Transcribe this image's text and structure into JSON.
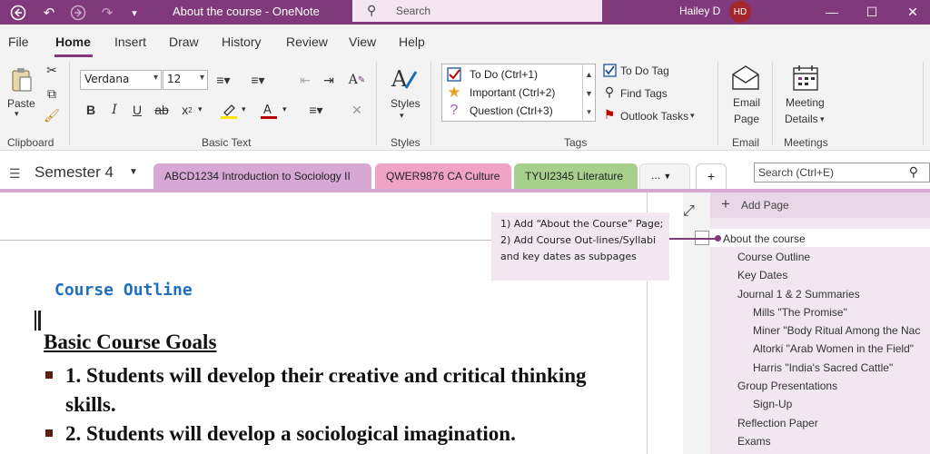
{
  "titlebar": {
    "title": "About the course  -  OneNote",
    "search_placeholder": "Search",
    "user_name": "Hailey D",
    "user_initials": "HD"
  },
  "menu": {
    "tabs": [
      "File",
      "Home",
      "Insert",
      "Draw",
      "History",
      "Review",
      "View",
      "Help"
    ],
    "active": "Home"
  },
  "ribbon": {
    "clipboard": {
      "paste_label": "Paste",
      "group_label": "Clipboard"
    },
    "basic_text": {
      "font": "Verdana",
      "size": "12",
      "group_label": "Basic Text"
    },
    "styles": {
      "label": "Styles",
      "group_label": "Styles"
    },
    "tags": {
      "items": [
        {
          "label": "To Do (Ctrl+1)",
          "icon": "checkbox-icon"
        },
        {
          "label": "Important (Ctrl+2)",
          "icon": "star-icon"
        },
        {
          "label": "Question (Ctrl+3)",
          "icon": "question-icon"
        }
      ],
      "todo_tag": "To Do Tag",
      "find_tags": "Find Tags",
      "outlook_tasks": "Outlook Tasks",
      "group_label": "Tags"
    },
    "email": {
      "label_line1": "Email",
      "label_line2": "Page",
      "group_label": "Email"
    },
    "meetings": {
      "label_line1": "Meeting",
      "label_line2": "Details",
      "group_label": "Meetings"
    }
  },
  "notebook": {
    "name": "Semester 4",
    "sections": [
      {
        "label": "ABCD1234 Introduction to Sociology II",
        "color": "#d8a8d4"
      },
      {
        "label": "QWER9876 CA Culture",
        "color": "#f0a3c4"
      },
      {
        "label": "TYUI2345 Literature",
        "color": "#a8d08d"
      }
    ],
    "more_label": "...",
    "add_label": "+",
    "search_placeholder": "Search (Ctrl+E)"
  },
  "page": {
    "note": "1) Add “About the Course” Page; 2) Add Course Out-lines/Syllabi and key dates as subpages",
    "outline_title": "Course Outline",
    "goals_heading": "Basic Course Goals",
    "goals": [
      "1. Students will develop their creative and critical thinking skills.",
      "2. Students will develop a sociological imagination."
    ]
  },
  "pages": {
    "add_label": "Add Page",
    "items": [
      {
        "label": "About the course",
        "level": 0
      },
      {
        "label": "Course Outline",
        "level": 1
      },
      {
        "label": "Key Dates",
        "level": 1
      },
      {
        "label": "Journal 1 & 2 Summaries",
        "level": 1
      },
      {
        "label": "Mills \"The Promise\"",
        "level": 2
      },
      {
        "label": "Miner \"Body Ritual Among the Nac",
        "level": 2
      },
      {
        "label": "Altorki \"Arab Women in the Field\"",
        "level": 2
      },
      {
        "label": "Harris \"India's Sacred Cattle\"",
        "level": 2
      },
      {
        "label": "Group Presentations",
        "level": 1
      },
      {
        "label": "Sign-Up",
        "level": 2
      },
      {
        "label": "Reflection Paper",
        "level": 1
      },
      {
        "label": "Exams",
        "level": 1
      }
    ]
  },
  "colors": {
    "accent": "#80397b",
    "outline_blue": "#1f6fc0"
  }
}
